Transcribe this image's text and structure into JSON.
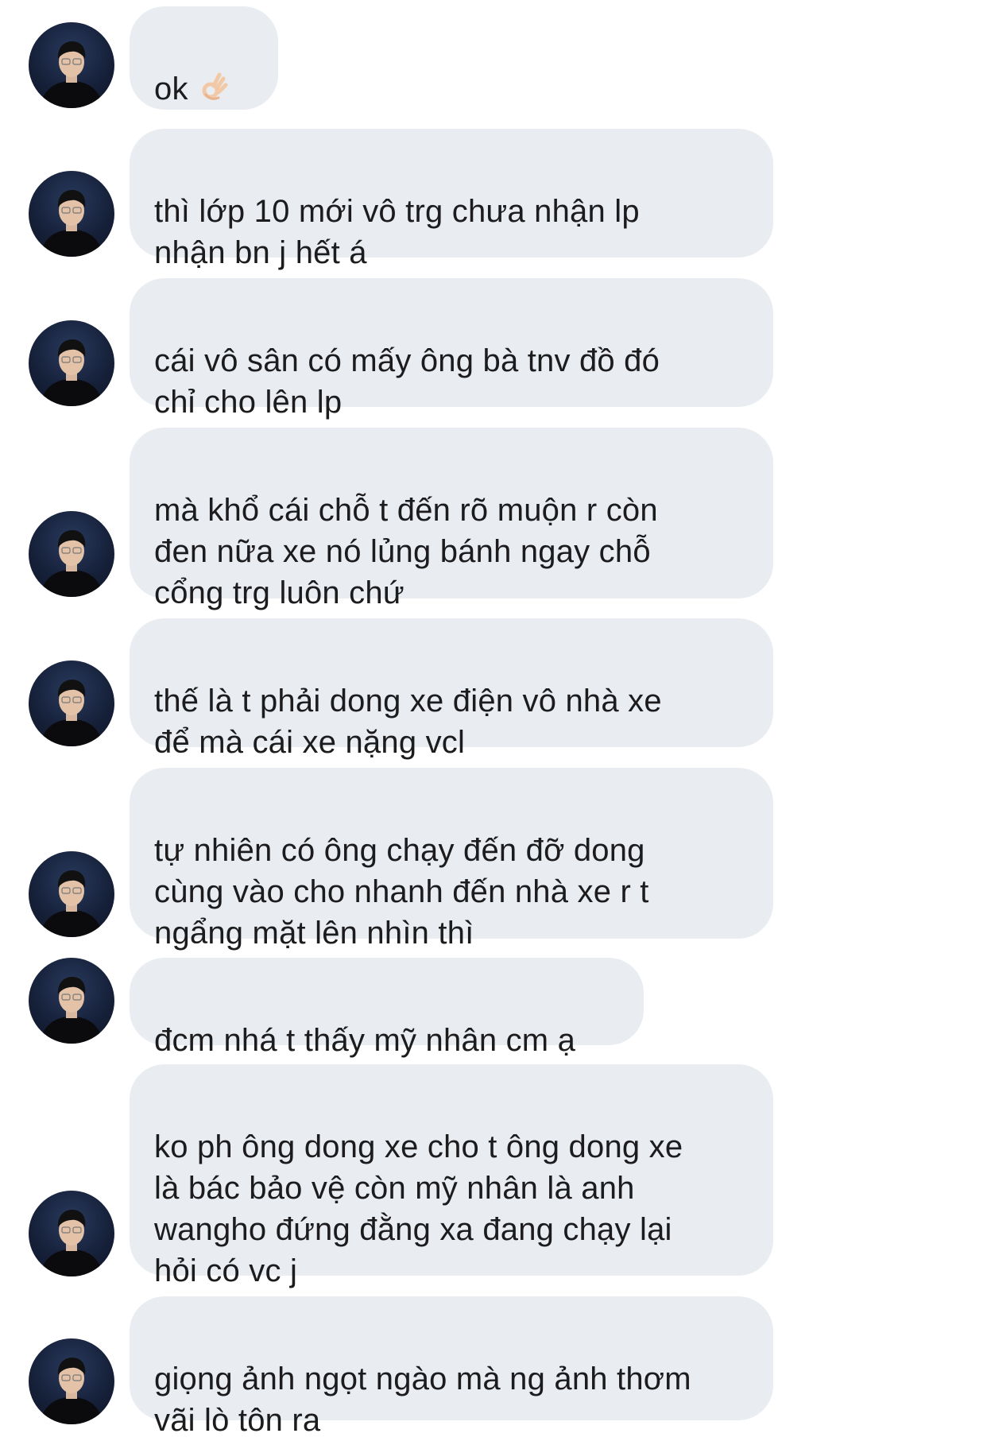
{
  "conversation": {
    "messages": [
      {
        "text": "ok",
        "emoji": "ok-hand-emoji"
      },
      {
        "text": "thì lớp 10 mới vô trg chưa nhận lp\nnhận bn j hết á"
      },
      {
        "text": "cái vô sân có mấy ông bà tnv đồ đó\nchỉ cho lên lp"
      },
      {
        "text": "mà khổ cái chỗ t đến rõ muộn r còn\nđen nữa xe nó lủng bánh ngay chỗ\ncổng trg luôn chứ"
      },
      {
        "text": "thế là t phải dong xe điện vô nhà xe\nđể mà cái xe nặng vcl"
      },
      {
        "text": "tự nhiên có ông chạy đến đỡ dong\ncùng vào cho nhanh đến nhà xe r t\nngẩng mặt lên nhìn thì"
      },
      {
        "text": "đcm nhá t thấy mỹ nhân cm ạ"
      },
      {
        "text": "ko ph ông dong xe cho t ông dong xe\nlà bác bảo vệ còn mỹ nhân là anh\nwangho đứng đằng xa đang chạy lại\nhỏi có vc j"
      },
      {
        "text": "giọng ảnh ngọt ngào mà ng ảnh thơm\nvãi lò tôn ra"
      }
    ]
  },
  "colors": {
    "bubble_background": "#e9ecf0",
    "text": "#1c1c1e",
    "page_background": "#ffffff"
  }
}
